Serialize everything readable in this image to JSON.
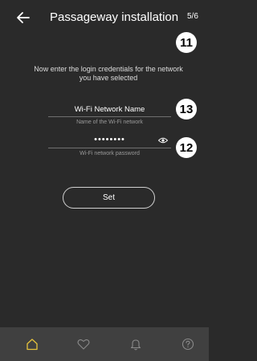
{
  "header": {
    "title": "Passageway installation",
    "step": "5/6",
    "back_icon": "arrow-left-icon"
  },
  "callouts": [
    "11",
    "13",
    "12"
  ],
  "instructions": "Now enter the login credentials for the network you have selected",
  "network_field": {
    "value": "Wi-Fi Network Name",
    "helper": "Name of the Wi-Fi network"
  },
  "password_field": {
    "value": "••••••••",
    "helper": "Wi-Fi network password",
    "toggle_icon": "eye-icon"
  },
  "set_button": {
    "label": "Set"
  },
  "bottom_nav": {
    "items": [
      {
        "icon": "home-icon",
        "active": true
      },
      {
        "icon": "heart-icon",
        "active": false
      },
      {
        "icon": "bell-icon",
        "active": false
      },
      {
        "icon": "help-icon",
        "active": false
      }
    ]
  },
  "colors": {
    "background": "#2a2a2a",
    "nav_background": "#404040",
    "accent": "#e6c33c",
    "nav_inactive": "#8a8a8a"
  }
}
